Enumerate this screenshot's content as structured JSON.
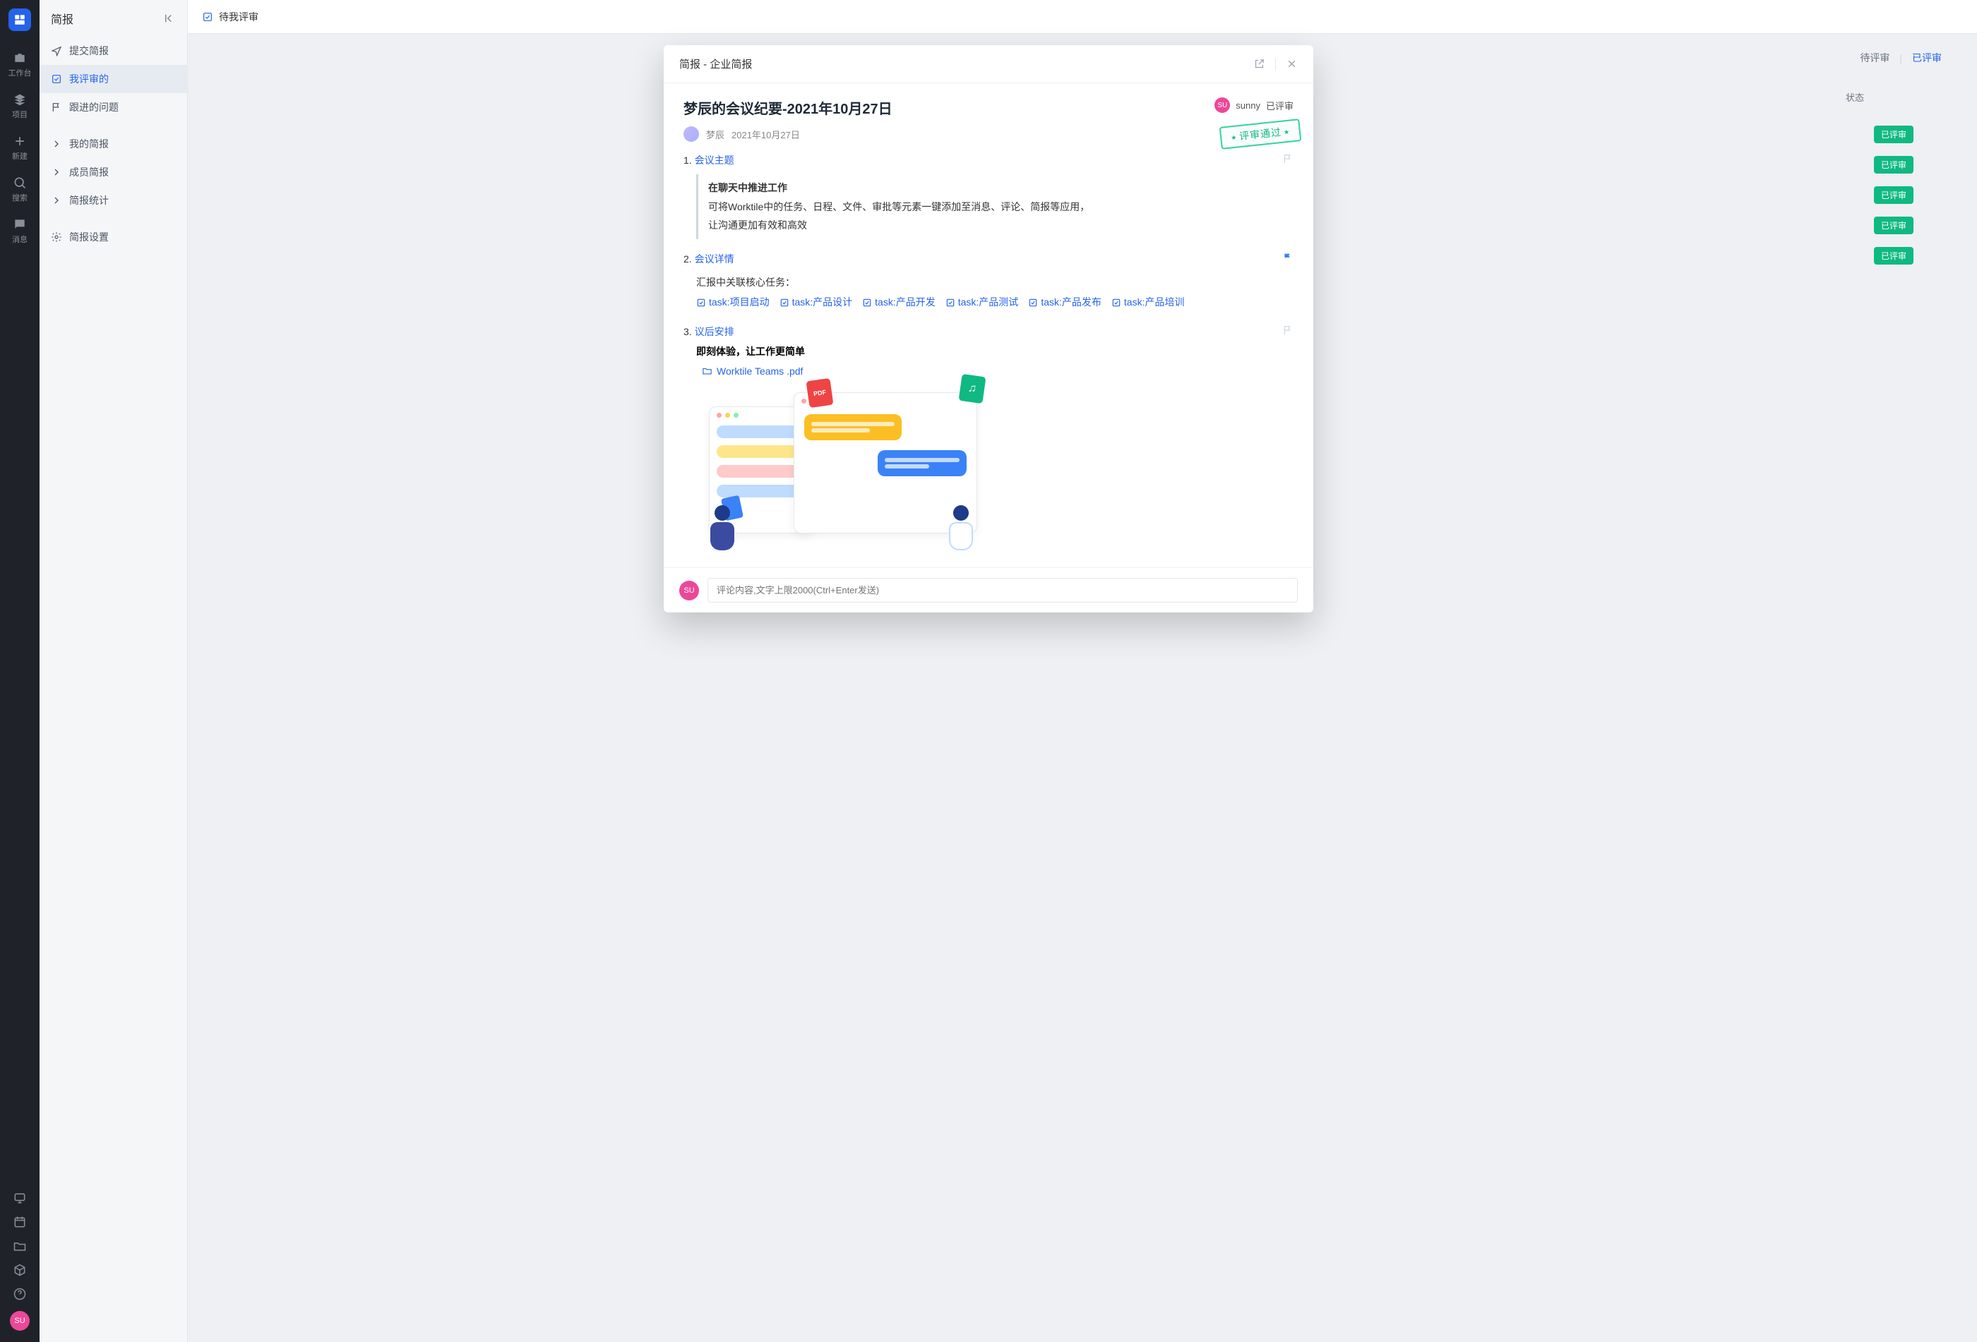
{
  "rail": {
    "items": [
      {
        "label": "工作台"
      },
      {
        "label": "项目"
      },
      {
        "label": "新建"
      },
      {
        "label": "搜索"
      },
      {
        "label": "消息"
      }
    ],
    "avatar": "SU"
  },
  "sidebar": {
    "title": "简报",
    "items": [
      {
        "label": "提交简报"
      },
      {
        "label": "我评审的",
        "active": true
      },
      {
        "label": "跟进的问题"
      },
      {
        "label": "我的简报"
      },
      {
        "label": "成员简报"
      },
      {
        "label": "简报统计"
      },
      {
        "label": "简报设置"
      }
    ]
  },
  "main": {
    "header_title": "待我评审",
    "tabs": {
      "pending": "待评审",
      "done": "已评审"
    },
    "status_header": "状态",
    "status_pill": "已评审"
  },
  "modal": {
    "breadcrumb": "简报 - 企业简报",
    "title": "梦辰的会议纪要-2021年10月27日",
    "author": "梦辰",
    "date": "2021年10月27日",
    "reviewer": {
      "avatar": "SU",
      "name": "sunny",
      "status": "已评审"
    },
    "stamp": "评审通过",
    "sections": {
      "s1": {
        "num": "1.",
        "title": "会议主题",
        "quote_bold": "在聊天中推进工作",
        "quote_l1": "可将Worktile中的任务、日程、文件、审批等元素一键添加至消息、评论、简报等应用，",
        "quote_l2": "让沟通更加有效和高效"
      },
      "s2": {
        "num": "2.",
        "title": "会议详情",
        "intro": "汇报中关联核心任务：",
        "tasks": [
          "task:项目启动",
          "task:产品设计",
          "task:产品开发",
          "task:产品测试",
          "task:产品发布",
          "task:产品培训"
        ]
      },
      "s3": {
        "num": "3.",
        "title": "议后安排",
        "bold": "即刻体验，让工作更简单",
        "file": "Worktile Teams .pdf"
      }
    },
    "comment_placeholder": "评论内容,文字上限2000(Ctrl+Enter发送)",
    "comment_avatar": "SU"
  }
}
